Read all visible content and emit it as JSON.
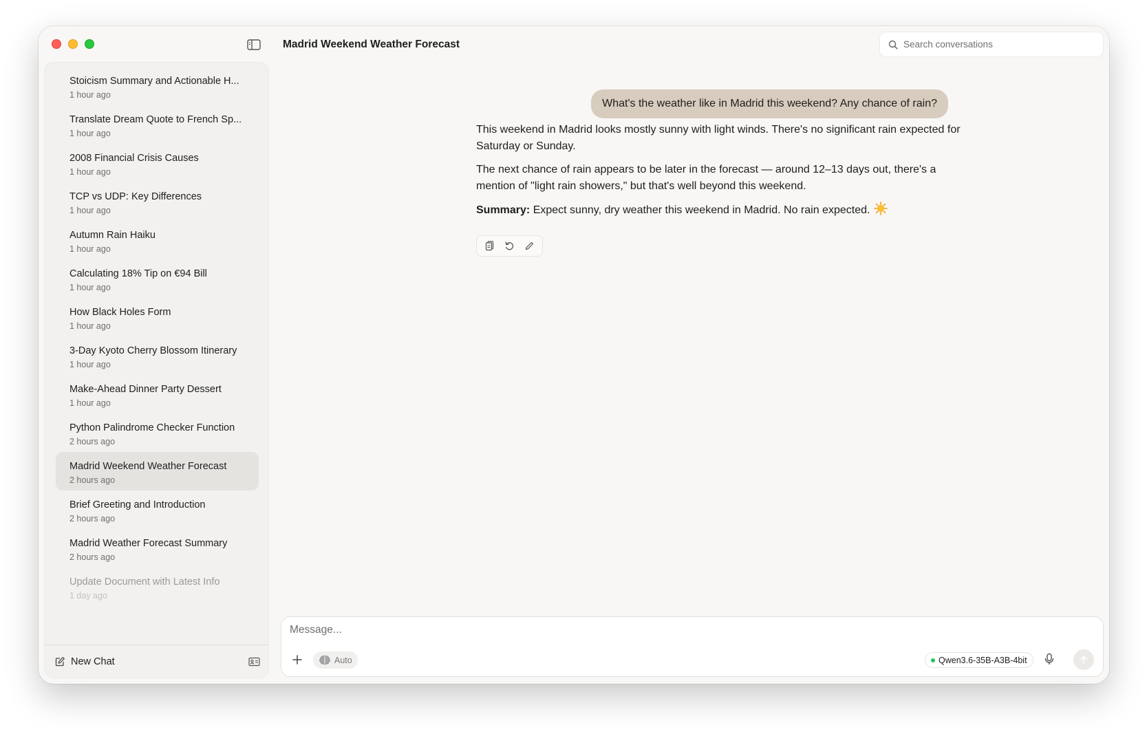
{
  "window": {
    "title": "Madrid Weekend Weather Forecast",
    "search_placeholder": "Search conversations"
  },
  "sidebar": {
    "items": [
      {
        "title": "Stoicism Summary and Actionable H...",
        "time": "1 hour ago"
      },
      {
        "title": "Translate Dream Quote to French Sp...",
        "time": "1 hour ago"
      },
      {
        "title": "2008 Financial Crisis Causes",
        "time": "1 hour ago"
      },
      {
        "title": "TCP vs UDP: Key Differences",
        "time": "1 hour ago"
      },
      {
        "title": "Autumn Rain Haiku",
        "time": "1 hour ago"
      },
      {
        "title": "Calculating 18% Tip on €94 Bill",
        "time": "1 hour ago"
      },
      {
        "title": "How Black Holes Form",
        "time": "1 hour ago"
      },
      {
        "title": "3-Day Kyoto Cherry Blossom Itinerary",
        "time": "1 hour ago"
      },
      {
        "title": "Make-Ahead Dinner Party Dessert",
        "time": "1 hour ago"
      },
      {
        "title": "Python Palindrome Checker Function",
        "time": "2 hours ago"
      },
      {
        "title": "Madrid Weekend Weather Forecast",
        "time": "2 hours ago"
      },
      {
        "title": "Brief Greeting and Introduction",
        "time": "2 hours ago"
      },
      {
        "title": "Madrid Weather Forecast Summary",
        "time": "2 hours ago"
      },
      {
        "title": "Update Document with Latest Info",
        "time": "1 day ago"
      }
    ],
    "active_index": 10,
    "new_chat_label": "New Chat"
  },
  "chat": {
    "user_message": "What's the weather like in Madrid this weekend? Any chance of rain?",
    "assistant": {
      "p1": "This weekend in Madrid looks mostly sunny with light winds. There's no significant rain expected for Saturday or Sunday.",
      "p2": "The next chance of rain appears to be later in the forecast — around 12–13 days out, there's a mention of \"light rain showers,\" but that's well beyond this weekend.",
      "summary_label": "Summary:",
      "summary_text": " Expect sunny, dry weather this weekend in Madrid. No rain expected."
    },
    "actions": [
      "copy-icon",
      "regenerate-icon",
      "edit-icon"
    ]
  },
  "composer": {
    "placeholder": "Message...",
    "auto_label": "Auto",
    "model_name": "Qwen3.6-35B-A3B-4bit",
    "model_status_color": "#22c55e"
  },
  "colors": {
    "user_bubble": "#d8ccbe",
    "active_item": "#e5e3e0",
    "background": "#f8f7f5"
  }
}
